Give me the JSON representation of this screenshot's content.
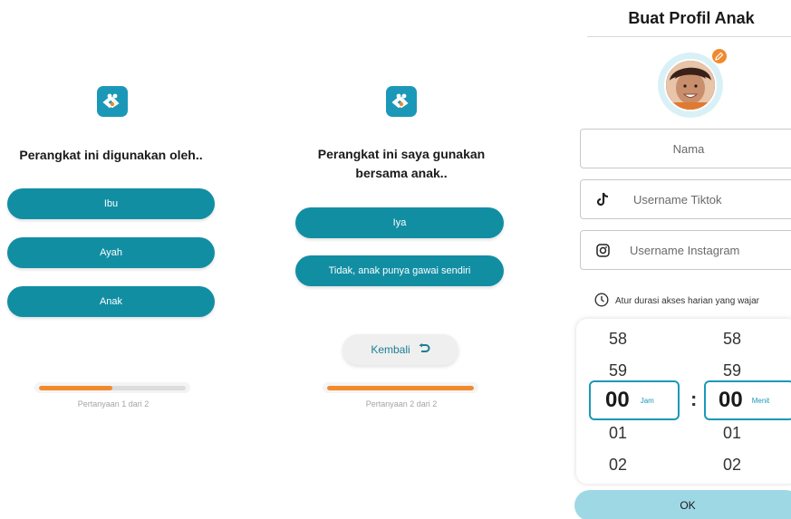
{
  "screen1": {
    "question": "Perangkat ini digunakan oleh..",
    "options": [
      "Ibu",
      "Ayah",
      "Anak"
    ],
    "progress_fraction": 0.5,
    "progress_label": "Pertanyaan 1 dari 2"
  },
  "screen2": {
    "question": "Perangkat ini saya gunakan bersama anak..",
    "options": [
      "Iya",
      "Tidak, anak punya gawai sendiri"
    ],
    "back_label": "Kembali",
    "progress_fraction": 1.0,
    "progress_label": "Pertanyaan 2 dari 2"
  },
  "screen3": {
    "title": "Buat Profil Anak",
    "fields": {
      "name_placeholder": "Nama",
      "tiktok_placeholder": "Username Tiktok",
      "instagram_placeholder": "Username Instagram"
    },
    "duration_label": "Atur durasi akses harian yang wajar",
    "picker": {
      "hours_above": [
        "58",
        "59"
      ],
      "hours_selected": "00",
      "hours_below": [
        "01",
        "02"
      ],
      "hours_unit": "Jam",
      "minutes_above": [
        "58",
        "59"
      ],
      "minutes_selected": "00",
      "minutes_below": [
        "01",
        "02"
      ],
      "minutes_unit": "Menit",
      "separator": ":"
    },
    "ok_label": "OK"
  },
  "colors": {
    "primary": "#128ea3",
    "accent": "#f08a2d",
    "ok_button": "#9fd8e5"
  },
  "icons": [
    "app-logo-icon",
    "undo-arrow-icon",
    "tiktok-icon",
    "instagram-icon",
    "clock-icon",
    "pencil-icon"
  ]
}
